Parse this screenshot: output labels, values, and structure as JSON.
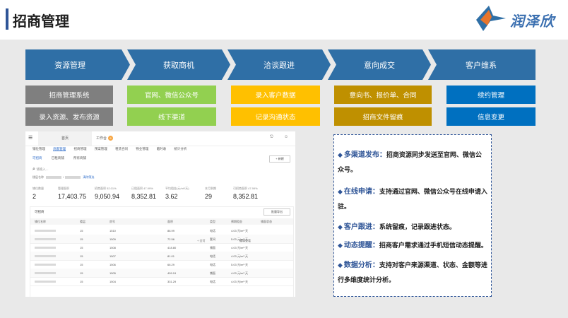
{
  "header": {
    "title": "招商管理",
    "logo_text": "润泽欣"
  },
  "colors": {
    "flow": "#2f6fa6",
    "gray": "#7f7f7f",
    "green": "#92d050",
    "yellow": "#ffc000",
    "olive": "#bf9000",
    "blue": "#0070c0",
    "accent": "#2f5597"
  },
  "flow": [
    "资源管理",
    "获取商机",
    "洽谈跟进",
    "意向成交",
    "客户维系"
  ],
  "tags": [
    [
      "招商管理系统",
      "录入资源、发布资源"
    ],
    [
      "官网、微信公众号",
      "线下渠道"
    ],
    [
      "录入客户数据",
      "记录沟通状态"
    ],
    [
      "意向书、报价单、合同",
      "招商文件留痕"
    ],
    [
      "续约管理",
      "信息变更"
    ]
  ],
  "screenshot": {
    "tab_home": "首页",
    "tab_workbench": "工作台",
    "badge": "8",
    "menu": [
      "铺位管理",
      "商家管理",
      "招商管理",
      "预案管理",
      "租赁合同",
      "物业管理",
      "临时收",
      "统计分析"
    ],
    "sub_tabs": [
      "可招商",
      "已租商铺",
      "所有商铺"
    ],
    "new_button": "+ 新建",
    "search_placeholder": "请输入...",
    "filter_label": "楼层名称",
    "filter_link": "清除筛选",
    "stats": [
      {
        "label": "铺位数量",
        "value": "2"
      },
      {
        "label": "管理面积",
        "value": "17,403.75"
      },
      {
        "label": "招商面积 52.01%",
        "value": "9,050.94"
      },
      {
        "label": "已租面积 47.99%",
        "value": "8,352.81"
      },
      {
        "label": "平均租金(元/m²/天)",
        "value": "3.62"
      },
      {
        "label": "本月到期",
        "value": "29"
      },
      {
        "label": "可招商面积 47.99%",
        "value": "8,352.81"
      }
    ],
    "table_title": "可招商",
    "export_button": "批量导出",
    "columns": [
      "铺位名称",
      "楼层",
      "房号",
      "面积",
      "类型",
      "预期租金",
      "铺面状态"
    ],
    "rows": [
      [
        "15",
        "1510",
        "88.99",
        "电话",
        "4.03 元/m²·天"
      ],
      [
        "15",
        "1509",
        "72.56",
        "套间",
        "5.03 元/m²·天"
      ],
      [
        "15",
        "1508",
        "418.80",
        "铺面",
        "4.03 元/m²·天"
      ],
      [
        "15",
        "1507",
        "81.01",
        "电话",
        "4.03 元/m²·天"
      ],
      [
        "15",
        "1506",
        "66.29",
        "电话",
        "5.03 元/m²·天"
      ],
      [
        "15",
        "1505",
        "409.19",
        "铺面",
        "4.03 元/m²·天"
      ],
      [
        "15",
        "1504",
        "331.29",
        "电话",
        "4.03 元/m²·天"
      ]
    ],
    "row_action_edit": "编辑查看",
    "row_action_view": "+ 全可"
  },
  "features": [
    {
      "key": "多渠道发布",
      "text": "招商资源同步发送至官网、微信公众号。"
    },
    {
      "key": "在线申请",
      "text": "支持通过官网、微信公众号在线申请入驻。"
    },
    {
      "key": "客户跟进",
      "text": "系统留痕，记录跟进状态。"
    },
    {
      "key": "动态提醒",
      "text": "招商客户需求通过手机短信动态提醒。"
    },
    {
      "key": "数据分析",
      "text": "支持对客户来源渠道、状态、金额等进行多维度统计分析。"
    }
  ]
}
